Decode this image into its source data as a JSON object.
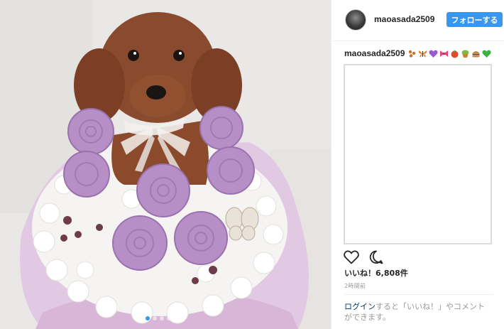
{
  "post": {
    "username": "maoasada2509",
    "follow_label": "フォローする",
    "caption_username": "maoasada2509",
    "caption_emojis": [
      "paw-prints",
      "butterfly",
      "purple-heart",
      "ribbon-bow",
      "tomato",
      "cupcake",
      "burger",
      "green-heart"
    ],
    "likes": "いいね！6,808件",
    "timestamp": "2時間前",
    "login_link": "ログイン",
    "login_rest_line1": "すると「いいね！」やコメント",
    "login_rest_line2": "ができます。"
  },
  "colors": {
    "follow_button": "#3897f0",
    "link": "#003569",
    "muted_text": "#999999"
  }
}
